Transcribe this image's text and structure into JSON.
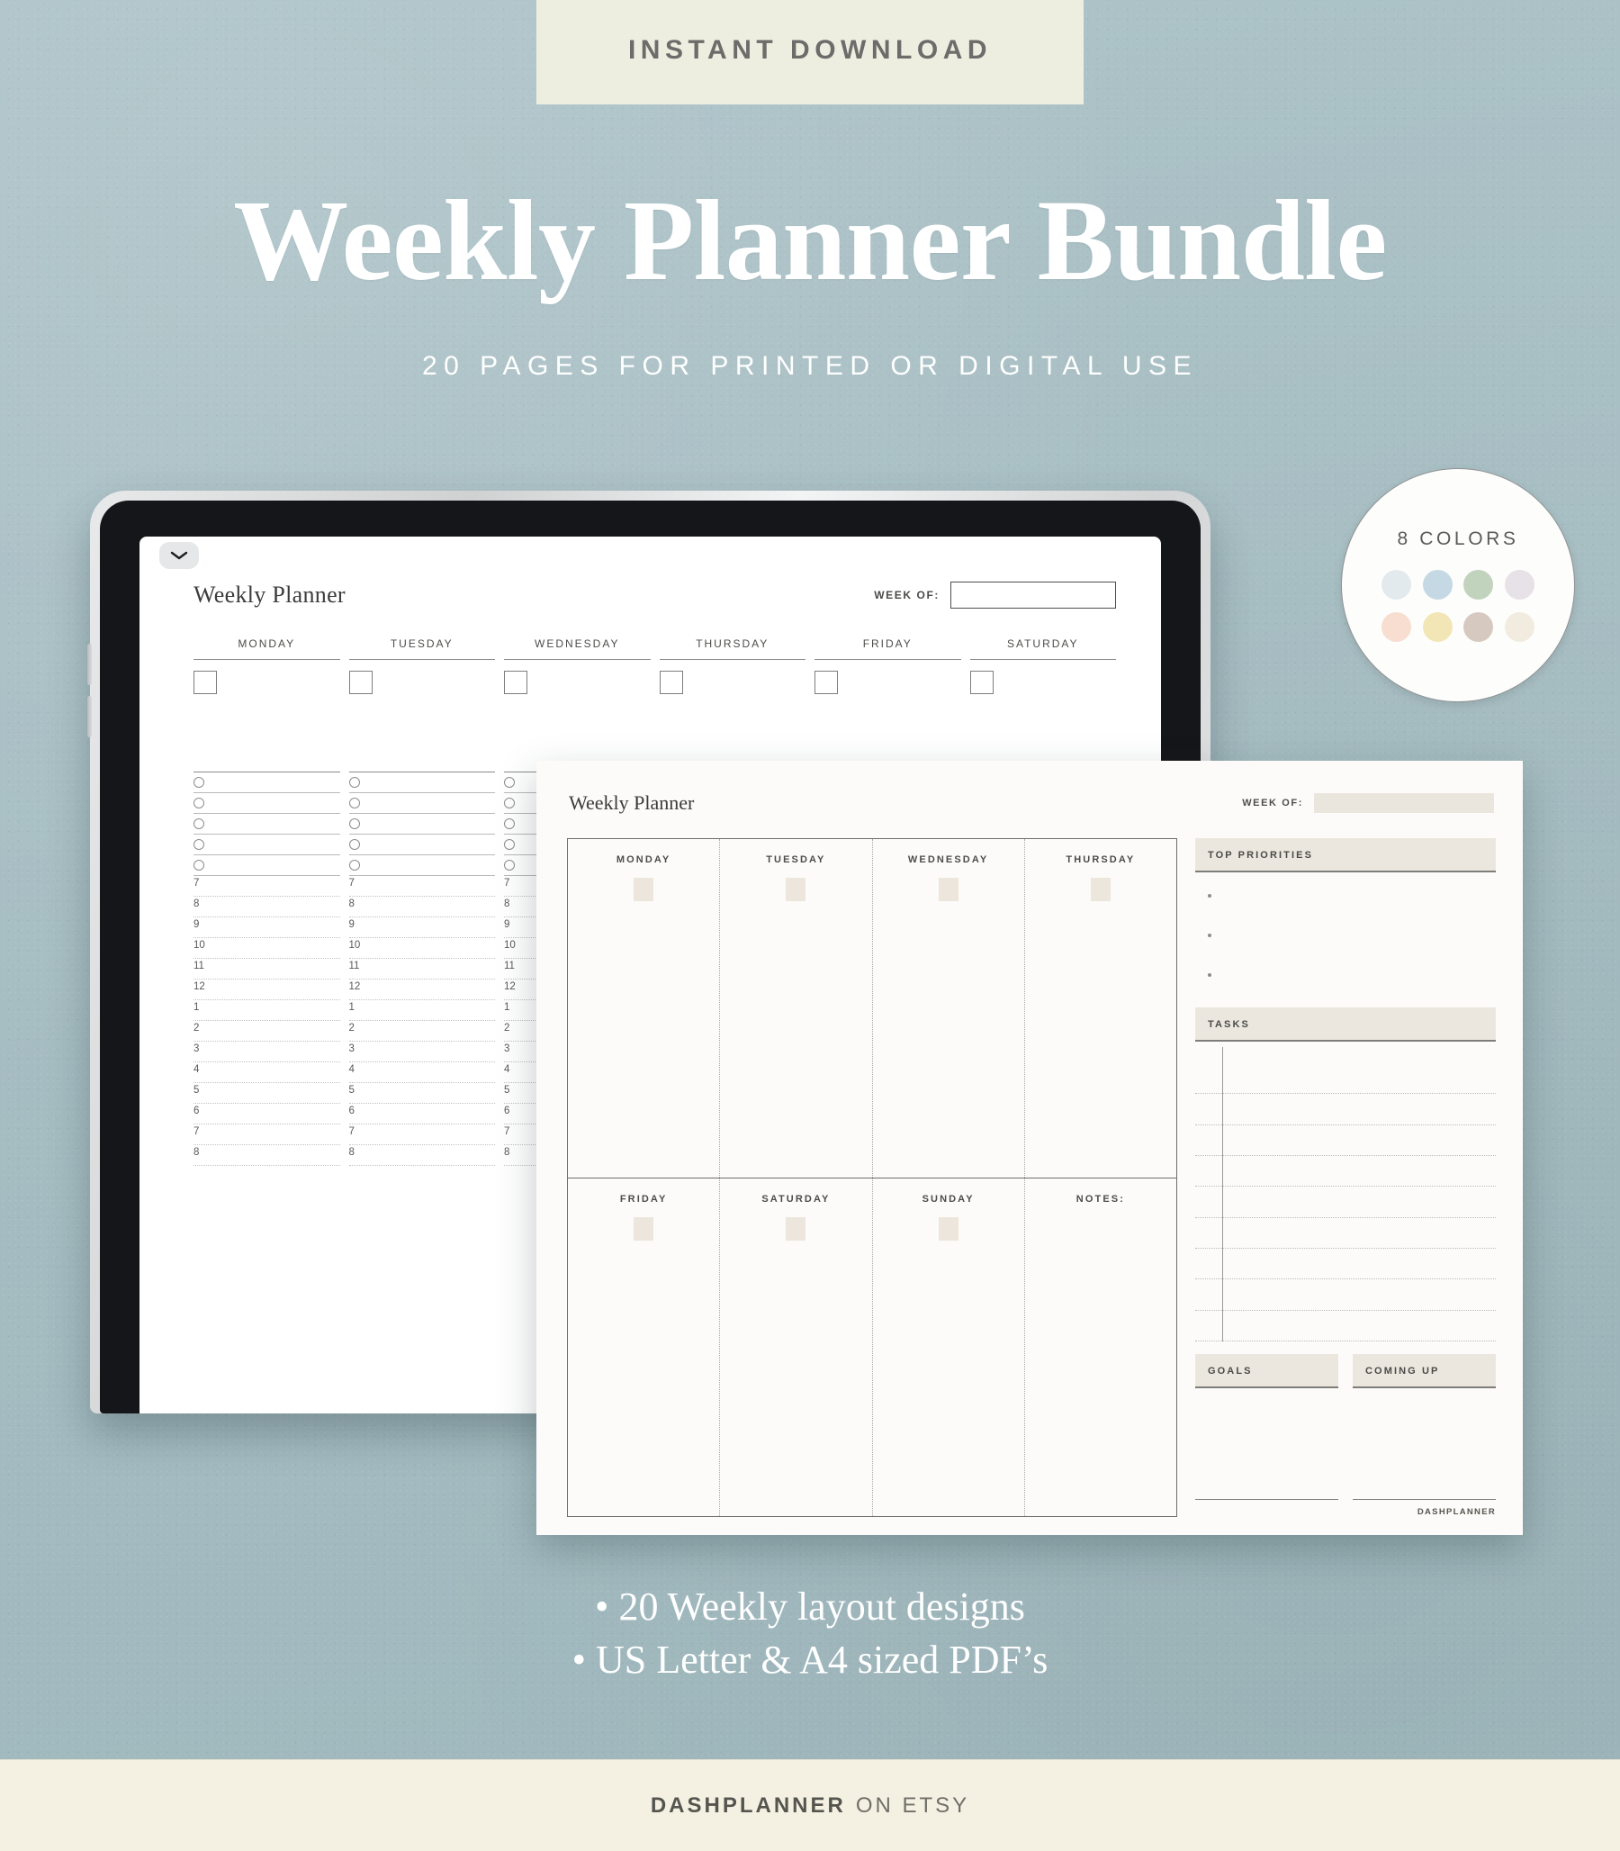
{
  "banner": {
    "text": "INSTANT DOWNLOAD"
  },
  "hero": {
    "title": "Weekly Planner Bundle",
    "subtitle": "20 PAGES FOR PRINTED OR DIGITAL USE"
  },
  "badge": {
    "caption": "8 COLORS",
    "swatches": [
      {
        "name": "pale-grey-blue",
        "hex": "#e3eaed"
      },
      {
        "name": "soft-blue",
        "hex": "#c4d9e3"
      },
      {
        "name": "sage-green",
        "hex": "#c2d3bd"
      },
      {
        "name": "lilac",
        "hex": "#e7e1e8"
      },
      {
        "name": "peach",
        "hex": "#f7ded0"
      },
      {
        "name": "butter-yellow",
        "hex": "#f3e6b6"
      },
      {
        "name": "taupe",
        "hex": "#d6c9bf"
      },
      {
        "name": "cream",
        "hex": "#f2ece0"
      }
    ]
  },
  "tablet_page": {
    "title": "Weekly Planner",
    "week_of_label": "WEEK OF:",
    "week_of_value": "",
    "days": [
      "MONDAY",
      "TUESDAY",
      "WEDNESDAY",
      "THURSDAY",
      "FRIDAY",
      "SATURDAY"
    ],
    "bullet_rows": 5,
    "hours": [
      "7",
      "8",
      "9",
      "10",
      "11",
      "12",
      "1",
      "2",
      "3",
      "4",
      "5",
      "6",
      "7",
      "8"
    ]
  },
  "front_page": {
    "title": "Weekly Planner",
    "week_of_label": "WEEK OF:",
    "week_of_value": "",
    "grid_top": [
      "MONDAY",
      "TUESDAY",
      "WEDNESDAY",
      "THURSDAY"
    ],
    "grid_bottom": [
      "FRIDAY",
      "SATURDAY",
      "SUNDAY",
      "NOTES:"
    ],
    "top_priorities_label": "TOP PRIORITIES",
    "priority_rows": 3,
    "tasks_label": "TASKS",
    "task_rows": 9,
    "goals_label": "GOALS",
    "coming_up_label": "COMING UP",
    "watermark": "DASHPLANNER"
  },
  "features": [
    "• 20 Weekly layout designs",
    "• US Letter & A4 sized PDF’s"
  ],
  "footer": {
    "brand": "DASHPLANNER",
    "suffix": "ON ETSY"
  }
}
